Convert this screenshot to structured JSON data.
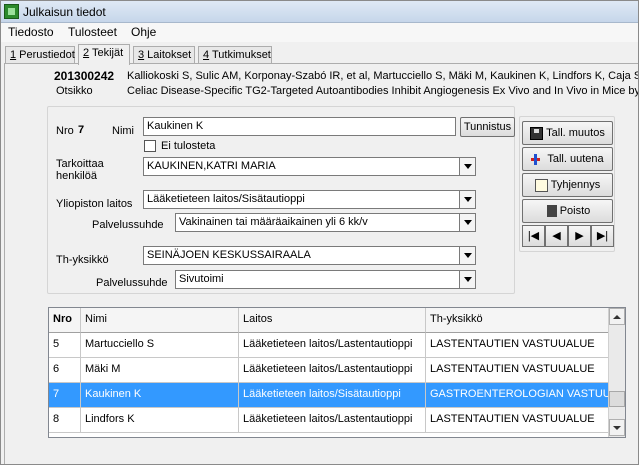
{
  "window": {
    "title": "Julkaisun tiedot"
  },
  "menu": [
    "Tiedosto",
    "Tulosteet",
    "Ohje"
  ],
  "tabs": [
    {
      "num": "1",
      "label": " Perustiedot",
      "active": false
    },
    {
      "num": "2",
      "label": " Tekijät",
      "active": true
    },
    {
      "num": "3",
      "label": " Laitokset",
      "active": false
    },
    {
      "num": "4",
      "label": " Tutkimukset",
      "active": false
    }
  ],
  "publication": {
    "id": "201300242",
    "authors": "Kalliokoski S, Sulic AM, Korponay-Szabó IR, et al, Martucciello S, Mäki M, Kaukinen K, Lindfors K, Caja S",
    "title_label": "Otsikko",
    "title": "Celiac Disease-Specific TG2-Targeted Autoantibodies Inhibit Angiogenesis Ex Vivo and In Vivo in Mice by I"
  },
  "form": {
    "nro_label": "Nro",
    "nro_value": "7",
    "nimi_label": "Nimi",
    "nimi_value": "Kaukinen K",
    "tunnistus_button": "Tunnistus",
    "ei_tulosteta_label": "Ei tulosteta",
    "tarkoittaa_label": "Tarkoittaa henkilöä",
    "tarkoittaa_value": "KAUKINEN,KATRI MARIA",
    "yliopisto_label": "Yliopiston laitos",
    "yliopisto_value": "Lääketieteen laitos/Sisätautioppi",
    "palvelussuhde_label": "Palvelussuhde",
    "palvelussuhde_value": "Vakinainen tai määräaikainen yli 6 kk/v",
    "th_label": "Th-yksikkö",
    "th_value": "SEINÄJOEN KESKUSSAIRAALA",
    "palvelussuhde2_label": "Palvelussuhde",
    "palvelussuhde2_value": "Sivutoimi"
  },
  "actions": {
    "save_change": "Tall. muutos",
    "save_new": "Tall. uutena",
    "clear": "Tyhjennys",
    "delete": "Poisto",
    "nav_first": "|◀",
    "nav_prev": "◀",
    "nav_next": "▶",
    "nav_last": "▶|"
  },
  "grid": {
    "columns": [
      "Nro",
      "Nimi",
      "Laitos",
      "Th-yksikkö"
    ],
    "rows": [
      {
        "nro": "5",
        "nimi": "Martucciello S",
        "laitos": "Lääketieteen laitos/Lastentautioppi",
        "th": "LASTENTAUTIEN VASTUUALUE",
        "selected": false
      },
      {
        "nro": "6",
        "nimi": "Mäki M",
        "laitos": "Lääketieteen laitos/Lastentautioppi",
        "th": "LASTENTAUTIEN VASTUUALUE",
        "selected": false
      },
      {
        "nro": "7",
        "nimi": "Kaukinen K",
        "laitos": "Lääketieteen laitos/Sisätautioppi",
        "th": "GASTROENTEROLOGIAN VASTUU",
        "selected": true
      },
      {
        "nro": "8",
        "nimi": "Lindfors K",
        "laitos": "Lääketieteen laitos/Lastentautioppi",
        "th": "LASTENTAUTIEN VASTUUALUE",
        "selected": false
      }
    ]
  },
  "colors": {
    "selection": "#3399ff",
    "titlebar": "#c6d6ea"
  }
}
